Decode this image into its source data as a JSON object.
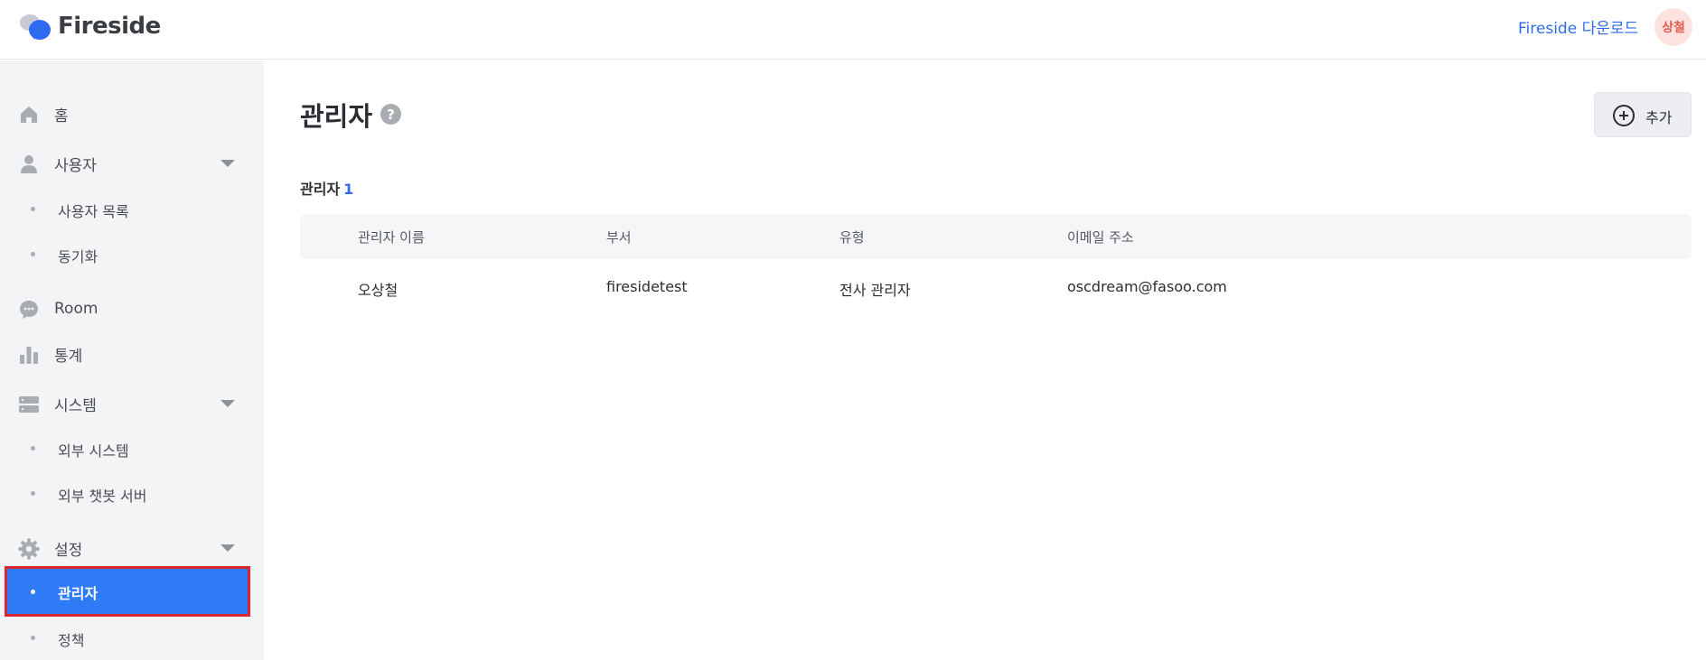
{
  "header": {
    "logo_text": "Fireside",
    "download_link": "Fireside 다운로드",
    "avatar_text": "상철"
  },
  "sidebar": {
    "home": "홈",
    "users": "사용자",
    "users_sub": [
      "사용자 목록",
      "동기화"
    ],
    "room": "Room",
    "stats": "통계",
    "system": "시스템",
    "system_sub": [
      "외부 시스템",
      "외부 챗봇 서버"
    ],
    "settings": "설정",
    "settings_sub": [
      "관리자",
      "정책"
    ],
    "active_item": "관리자"
  },
  "main": {
    "title": "관리자",
    "help": "?",
    "add_button": "추가",
    "section_label": "관리자",
    "section_count": "1",
    "columns": [
      "관리자 이름",
      "부서",
      "유형",
      "이메일 주소"
    ],
    "rows": [
      [
        "오상철",
        "firesidetest",
        "전사 관리자",
        "oscdream@fasoo.com"
      ]
    ]
  },
  "colors": {
    "accent": "#2f7af5",
    "link": "#2f6bf0",
    "highlight_border": "#d9262f",
    "sidebar_bg": "#f3f4f6"
  }
}
